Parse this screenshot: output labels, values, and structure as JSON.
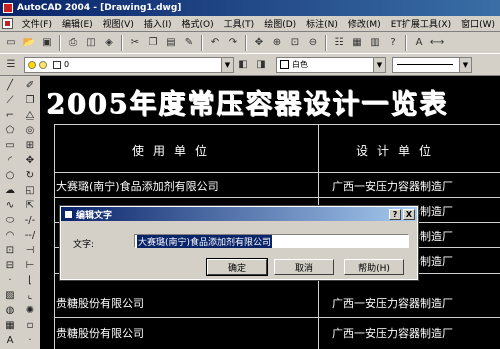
{
  "window": {
    "title": "AutoCAD 2004 - [Drawing1.dwg]"
  },
  "menu": [
    "文件(F)",
    "编辑(E)",
    "视图(V)",
    "插入(I)",
    "格式(O)",
    "工具(T)",
    "绘图(D)",
    "标注(N)",
    "修改(M)",
    "ET扩展工具(X)",
    "窗口(W)"
  ],
  "toolbar2": {
    "layer_value": "0",
    "color_value": "白色"
  },
  "drawing": {
    "title": "2005年度常压容器设计一览表",
    "header_col1": "使用单位",
    "header_col2": "设计单位",
    "row1_col1": "大赛璐(南宁)食品添加剂有限公司",
    "row1_col2": "广西一安压力容器制造厂",
    "row2_col2": "广西一安压力容器制造厂",
    "row3_col2": "广西一安压力容器制造厂",
    "row4_col2": "广西一安压力容器制造厂",
    "row5_col1": "贵糖股份有限公司",
    "row5_col2": "广西一安压力容器制造厂",
    "row6_col1": "贵糖股份有限公司",
    "row6_col2": "广西一安压力容器制造厂"
  },
  "dialog": {
    "title": "编辑文字",
    "help_q": "?",
    "close_x": "X",
    "label": "文字:",
    "value": "大赛璐(南宁)食品添加剂有限公司",
    "ok": "确定",
    "cancel": "取消",
    "help": "帮助(H)"
  }
}
